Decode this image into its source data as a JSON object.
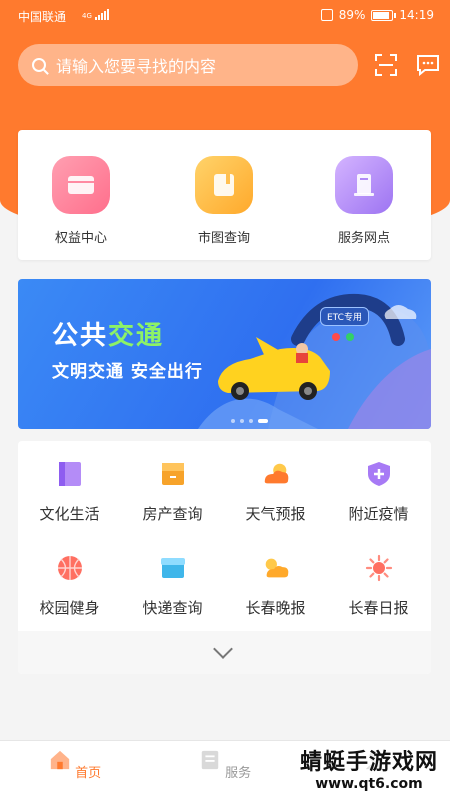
{
  "status_bar": {
    "carrier": "中国联通",
    "network": "4G",
    "battery": "89%",
    "battery_level": 0.89,
    "time": "14:19"
  },
  "search": {
    "placeholder": "请输入您要寻找的内容",
    "scan_icon": "scan-icon",
    "message_icon": "message-icon"
  },
  "quick_actions": [
    {
      "label": "权益中心",
      "icon": "card-icon",
      "color": "#ff7d98"
    },
    {
      "label": "市图查询",
      "icon": "book-icon",
      "color": "#ffb83f"
    },
    {
      "label": "服务网点",
      "icon": "kiosk-icon",
      "color": "#b28af7"
    }
  ],
  "banner": {
    "title_part1": "公共",
    "title_part2": "交通",
    "subtitle": "文明交通  安全出行",
    "etc_tag": "ETC专用",
    "slide_count": 4,
    "active_slide": 4
  },
  "services": [
    {
      "label": "文化生活",
      "icon": "book-icon",
      "color": "#9c6af5"
    },
    {
      "label": "房产查询",
      "icon": "folder-icon",
      "color": "#f7a32a"
    },
    {
      "label": "天气预报",
      "icon": "weather-icon",
      "color": "#ff7a2e"
    },
    {
      "label": "附近疫情",
      "icon": "shield-plus-icon",
      "color": "#9c6af5"
    },
    {
      "label": "校园健身",
      "icon": "basketball-icon",
      "color": "#ff6f61"
    },
    {
      "label": "快递查询",
      "icon": "box-icon",
      "color": "#3fb6ea"
    },
    {
      "label": "长春晚报",
      "icon": "sun-cloud-icon",
      "color": "#ffa92b"
    },
    {
      "label": "长春日报",
      "icon": "sun-icon",
      "color": "#ff6f61"
    }
  ],
  "tabbar": {
    "home": "首页",
    "service": "服务"
  },
  "watermark": {
    "line1": "蜻蜓手游戏网",
    "line2": "www.qt6.com"
  },
  "colors": {
    "accent": "#ff7a2e"
  }
}
